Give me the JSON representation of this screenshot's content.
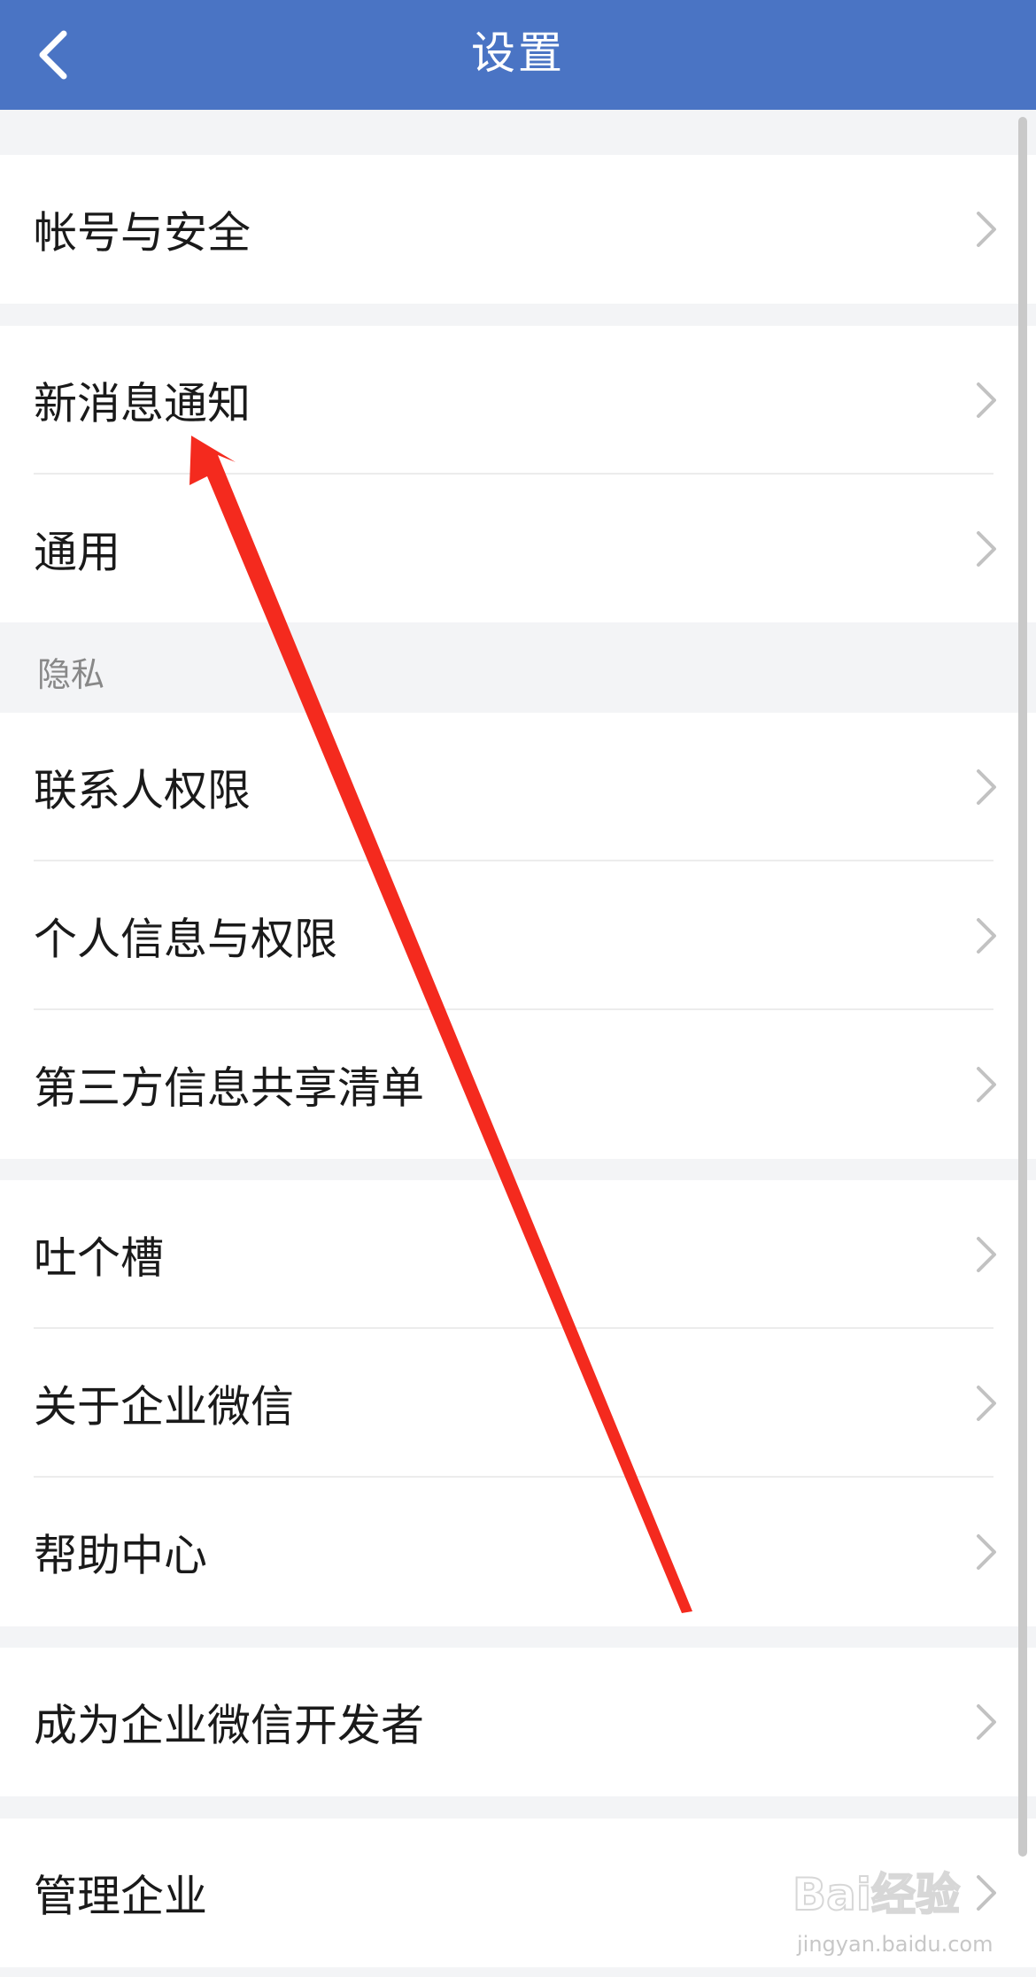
{
  "navbar": {
    "title": "设置",
    "back_icon": "chevron-left-icon"
  },
  "groups": [
    {
      "items": [
        {
          "label": "帐号与安全"
        }
      ]
    },
    {
      "items": [
        {
          "label": "新消息通知"
        },
        {
          "label": "通用"
        }
      ]
    },
    {
      "header": "隐私",
      "items": [
        {
          "label": "联系人权限"
        },
        {
          "label": "个人信息与权限"
        },
        {
          "label": "第三方信息共享清单"
        }
      ]
    },
    {
      "items": [
        {
          "label": "吐个槽"
        },
        {
          "label": "关于企业微信"
        },
        {
          "label": "帮助中心"
        }
      ]
    },
    {
      "items": [
        {
          "label": "成为企业微信开发者"
        }
      ]
    },
    {
      "items": [
        {
          "label": "管理企业"
        }
      ]
    }
  ],
  "annotation": {
    "color": "#f42a1e",
    "points_to": "新消息通知"
  },
  "watermark": {
    "logo": "Bai经验",
    "url": "jingyan.baidu.com"
  },
  "colors": {
    "navbar": "#4a74c4",
    "background": "#f3f4f6",
    "row": "#ffffff",
    "chevron": "#c2c2c2"
  }
}
